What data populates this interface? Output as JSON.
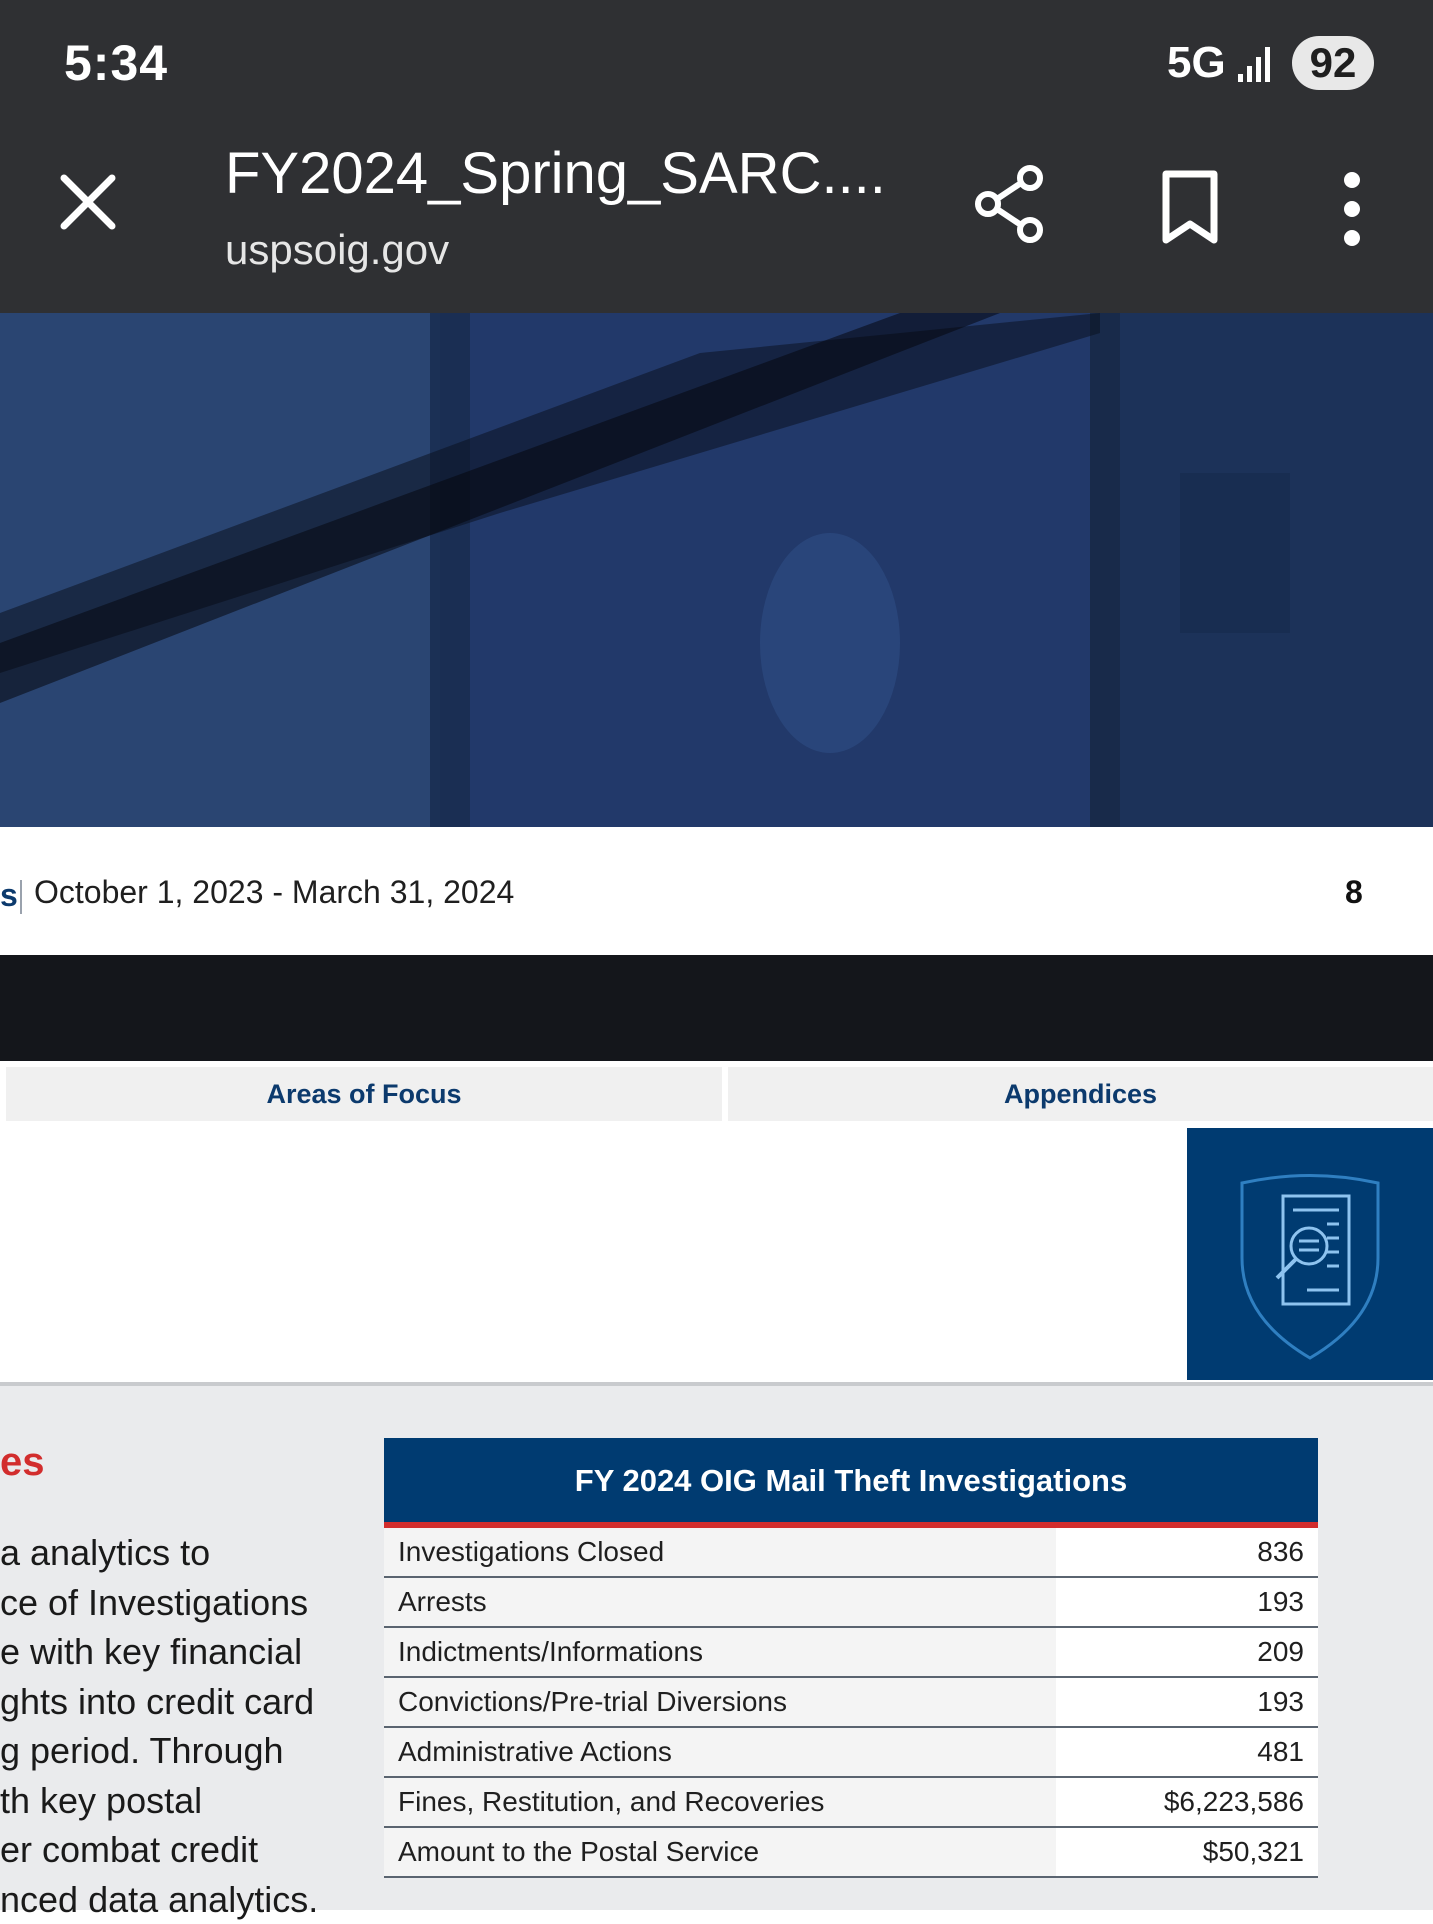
{
  "status_bar": {
    "time": "5:34",
    "network": "5G",
    "battery": "92"
  },
  "browser": {
    "title": "FY2024_Spring_SARC....",
    "domain": "uspsoig.gov",
    "icons": [
      "close-icon",
      "share-icon",
      "bookmark-icon",
      "more-vert-icon"
    ]
  },
  "page": {
    "prefix_fragment": "s",
    "date_range": "October 1, 2023 - March 31, 2024",
    "page_number": "8",
    "tabs": [
      {
        "label": "Areas of Focus"
      },
      {
        "label": "Appendices"
      }
    ],
    "heading_fragment": "es",
    "body_lines": [
      "a analytics to",
      "ce of Investigations",
      "e with key financial",
      "ghts into credit card",
      "g period. Through",
      "th key postal",
      "er combat credit",
      "nced data analytics."
    ],
    "colors": {
      "navy": "#003b71",
      "red": "#d22d2d",
      "dark": "#14161b"
    }
  },
  "table": {
    "title": "FY 2024 OIG Mail Theft Investigations",
    "rows": [
      {
        "label": "Investigations Closed",
        "value": "836"
      },
      {
        "label": "Arrests",
        "value": "193"
      },
      {
        "label": "Indictments/Informations",
        "value": "209"
      },
      {
        "label": "Convictions/Pre-trial Diversions",
        "value": "193"
      },
      {
        "label": "Administrative Actions",
        "value": "481"
      },
      {
        "label": "Fines, Restitution, and Recoveries",
        "value": "$6,223,586"
      },
      {
        "label": "Amount to the Postal Service",
        "value": "$50,321"
      }
    ]
  }
}
